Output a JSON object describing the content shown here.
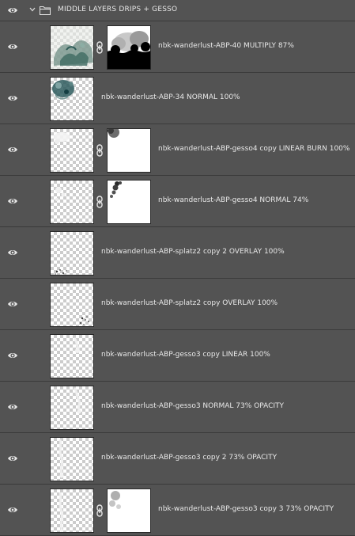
{
  "group": {
    "name": "MIDDLE LAYERS DRIPS + GESSO",
    "icon": "folder-icon",
    "expanded": true
  },
  "layers": [
    {
      "name": "nbk-wanderlust-ABP-40 MULTIPLY 87%"
    },
    {
      "name": "nbk-wanderlust-ABP-34 NORMAL 100%"
    },
    {
      "name": "nbk-wanderlust-ABP-gesso4 copy LINEAR BURN 100%"
    },
    {
      "name": "nbk-wanderlust-ABP-gesso4 NORMAL 74%"
    },
    {
      "name": "nbk-wanderlust-ABP-splatz2 copy 2 OVERLAY 100%"
    },
    {
      "name": "nbk-wanderlust-ABP-splatz2 copy OVERLAY 100%"
    },
    {
      "name": "nbk-wanderlust-ABP-gesso3 copy LINEAR 100%"
    },
    {
      "name": "nbk-wanderlust-ABP-gesso3 NORMAL 73% OPACITY"
    },
    {
      "name": "nbk-wanderlust-ABP-gesso3 copy 2  73% OPACITY"
    },
    {
      "name": "nbk-wanderlust-ABP-gesso3 copy 3  73% OPACITY"
    }
  ],
  "colors": {
    "panel_bg": "#535353",
    "divider": "#3a3a3a",
    "text": "#e8e8e8"
  }
}
